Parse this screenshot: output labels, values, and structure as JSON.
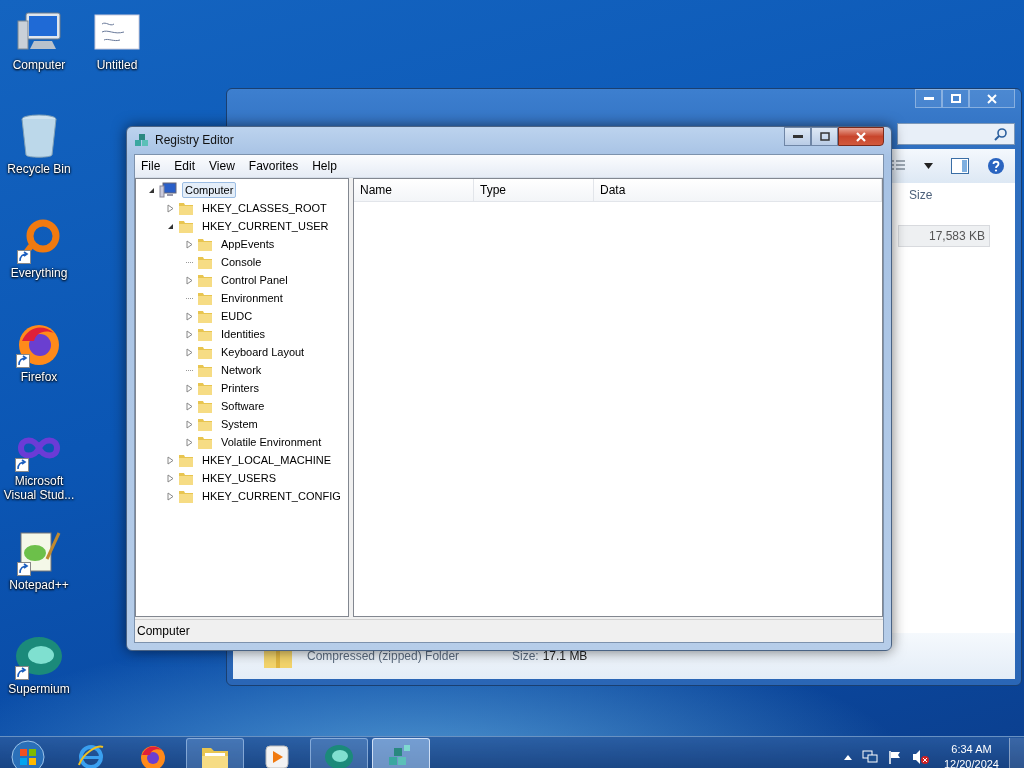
{
  "desktop_icons": [
    {
      "kind": "computer",
      "label": "Computer",
      "shortcut": false
    },
    {
      "kind": "trash",
      "label": "Recycle Bin",
      "shortcut": false
    },
    {
      "kind": "ring",
      "label": "Everything",
      "shortcut": true
    },
    {
      "kind": "fox",
      "label": "Firefox",
      "shortcut": true
    },
    {
      "kind": "infinity",
      "label": "Microsoft Visual Stud...",
      "shortcut": true
    },
    {
      "kind": "notepad",
      "label": "Notepad++",
      "shortcut": true
    },
    {
      "kind": "sphere",
      "label": "Supermium",
      "shortcut": true
    },
    {
      "kind": "document",
      "label": "Untitled",
      "shortcut": false
    }
  ],
  "explorer": {
    "column": "Size",
    "size_cell": "17,583 KB",
    "details": {
      "type": "Compressed (zipped) Folder",
      "size_label": "Size:",
      "size_value": "17.1 MB"
    }
  },
  "registry_editor": {
    "title": "Registry Editor",
    "menu": [
      "File",
      "Edit",
      "View",
      "Favorites",
      "Help"
    ],
    "tree": [
      {
        "label": "Computer",
        "kind": "computer",
        "expanded": true,
        "selected": true,
        "children": [
          {
            "label": "HKEY_CLASSES_ROOT",
            "has_subkeys": true,
            "expanded": false,
            "selected": false
          },
          {
            "label": "HKEY_CURRENT_USER",
            "expanded": true,
            "selected": false,
            "children": [
              {
                "label": "AppEvents",
                "has_subkeys": true,
                "expanded": false,
                "selected": false
              },
              {
                "label": "Console",
                "has_subkeys": false,
                "expanded": false,
                "selected": false
              },
              {
                "label": "Control Panel",
                "has_subkeys": true,
                "expanded": false,
                "selected": false
              },
              {
                "label": "Environment",
                "has_subkeys": false,
                "expanded": false,
                "selected": false
              },
              {
                "label": "EUDC",
                "has_subkeys": true,
                "expanded": false,
                "selected": false
              },
              {
                "label": "Identities",
                "has_subkeys": true,
                "expanded": false,
                "selected": false
              },
              {
                "label": "Keyboard Layout",
                "has_subkeys": true,
                "expanded": false,
                "selected": false
              },
              {
                "label": "Network",
                "has_subkeys": false,
                "expanded": false,
                "selected": false
              },
              {
                "label": "Printers",
                "has_subkeys": true,
                "expanded": false,
                "selected": false
              },
              {
                "label": "Software",
                "has_subkeys": true,
                "expanded": false,
                "selected": false
              },
              {
                "label": "System",
                "has_subkeys": true,
                "expanded": false,
                "selected": false
              },
              {
                "label": "Volatile Environment",
                "has_subkeys": true,
                "expanded": false,
                "selected": false
              }
            ]
          },
          {
            "label": "HKEY_LOCAL_MACHINE",
            "has_subkeys": true,
            "expanded": false,
            "selected": false
          },
          {
            "label": "HKEY_USERS",
            "has_subkeys": true,
            "expanded": false,
            "selected": false
          },
          {
            "label": "HKEY_CURRENT_CONFIG",
            "has_subkeys": true,
            "expanded": false,
            "selected": false
          }
        ]
      }
    ],
    "columns": [
      "Name",
      "Type",
      "Data"
    ],
    "status_bar": "Computer"
  },
  "taskbar": {
    "items": [
      {
        "kind": "ie",
        "open": false,
        "active": false
      },
      {
        "kind": "firefox",
        "open": false,
        "active": false
      },
      {
        "kind": "folder",
        "open": true,
        "active": false
      },
      {
        "kind": "media",
        "open": false,
        "active": false
      },
      {
        "kind": "sphere",
        "open": true,
        "active": false
      },
      {
        "kind": "registry",
        "open": true,
        "active": true
      }
    ],
    "time": "6:34 AM",
    "date": "12/20/2024"
  }
}
